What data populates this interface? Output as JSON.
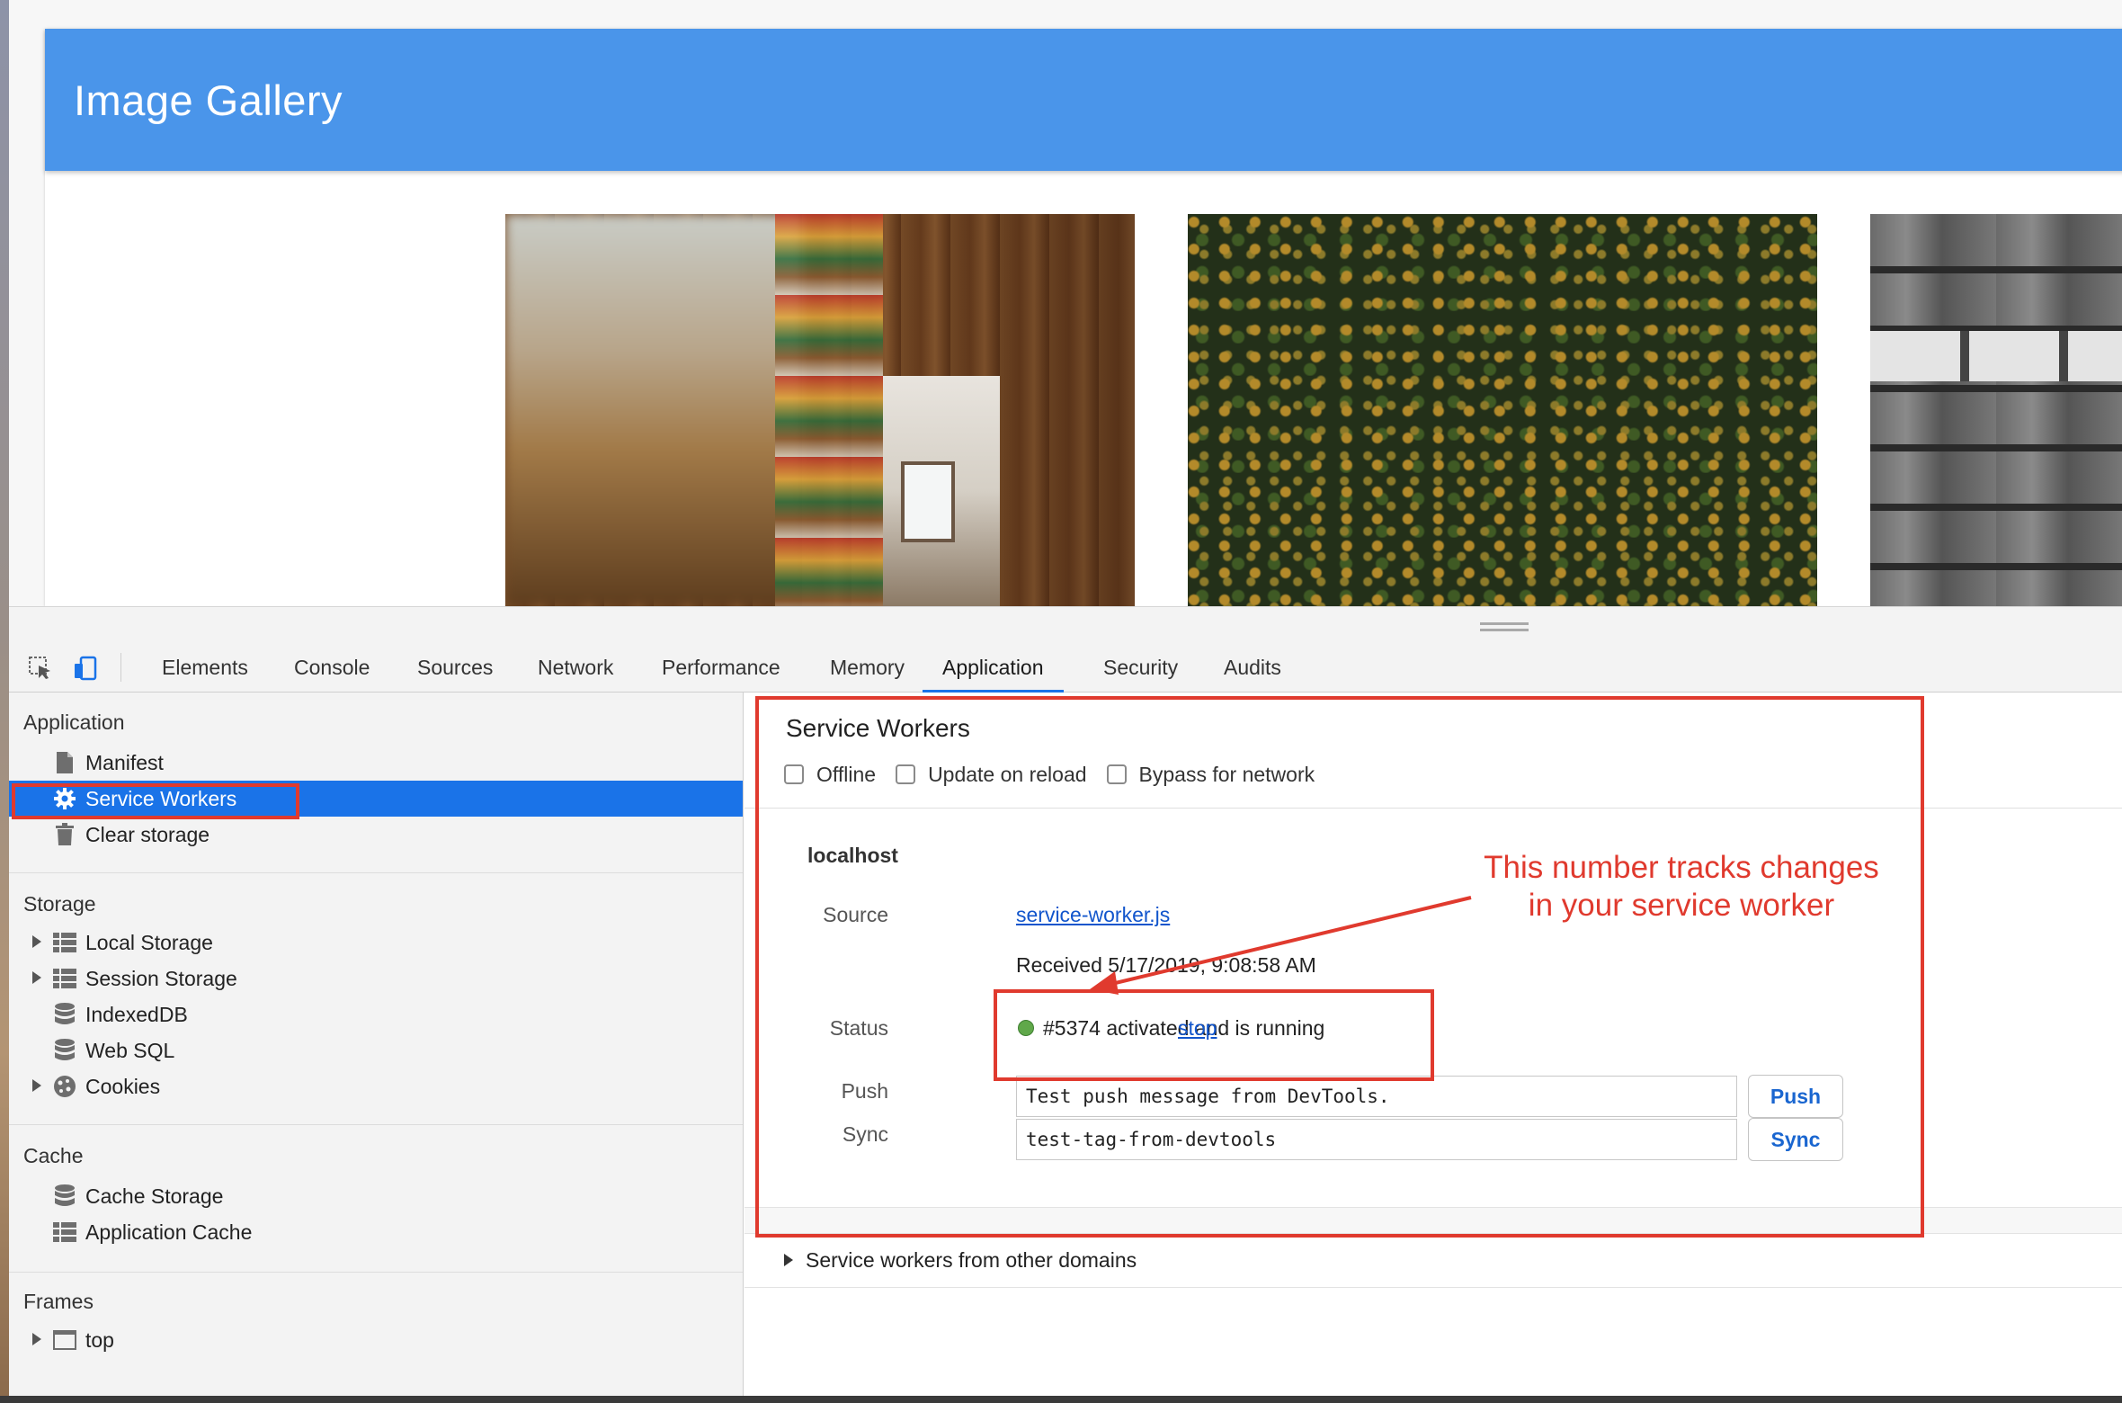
{
  "page": {
    "header_title": "Image Gallery",
    "photos": [
      "bookshelf-photo",
      "forest-aerial-photo",
      "brick-wall-photo"
    ]
  },
  "devtools": {
    "tabs": [
      {
        "label": "Elements",
        "active": false
      },
      {
        "label": "Console",
        "active": false
      },
      {
        "label": "Sources",
        "active": false
      },
      {
        "label": "Network",
        "active": false
      },
      {
        "label": "Performance",
        "active": false
      },
      {
        "label": "Memory",
        "active": false
      },
      {
        "label": "Application",
        "active": true
      },
      {
        "label": "Security",
        "active": false
      },
      {
        "label": "Audits",
        "active": false
      }
    ],
    "colors": {
      "accent": "#1a73e8",
      "annotation": "#e03a2e",
      "header": "#4a95ea",
      "status_running": "#60a84a"
    }
  },
  "sidebar": {
    "sections": {
      "application": "Application",
      "storage": "Storage",
      "cache": "Cache",
      "frames": "Frames"
    },
    "application_items": [
      {
        "label": "Manifest",
        "icon": "file-icon"
      },
      {
        "label": "Service Workers",
        "icon": "gear-icon",
        "selected": true
      },
      {
        "label": "Clear storage",
        "icon": "trash-icon"
      }
    ],
    "storage_items": [
      {
        "label": "Local Storage",
        "icon": "grid-icon",
        "expandable": true
      },
      {
        "label": "Session Storage",
        "icon": "grid-icon",
        "expandable": true
      },
      {
        "label": "IndexedDB",
        "icon": "database-icon",
        "expandable": false
      },
      {
        "label": "Web SQL",
        "icon": "database-icon",
        "expandable": false
      },
      {
        "label": "Cookies",
        "icon": "cookie-icon",
        "expandable": true
      }
    ],
    "cache_items": [
      {
        "label": "Cache Storage",
        "icon": "database-icon"
      },
      {
        "label": "Application Cache",
        "icon": "grid-icon"
      }
    ],
    "frames_items": [
      {
        "label": "top",
        "icon": "frame-icon",
        "expandable": true
      }
    ]
  },
  "service_workers": {
    "title": "Service Workers",
    "options": [
      "Offline",
      "Update on reload",
      "Bypass for network"
    ],
    "origin": "localhost",
    "source_label": "Source",
    "source_file": "service-worker.js",
    "received": "Received 5/17/2019, 9:08:58 AM",
    "status_label": "Status",
    "status_text": "#5374 activated and is running",
    "stop_label": "stop",
    "push_label": "Push",
    "push_value": "Test push message from DevTools.",
    "push_button": "Push",
    "sync_label": "Sync",
    "sync_value": "test-tag-from-devtools",
    "sync_button": "Sync",
    "other_domains": "Service workers from other domains"
  },
  "annotation": {
    "line1": "This number tracks changes",
    "line2": "in your service worker"
  }
}
